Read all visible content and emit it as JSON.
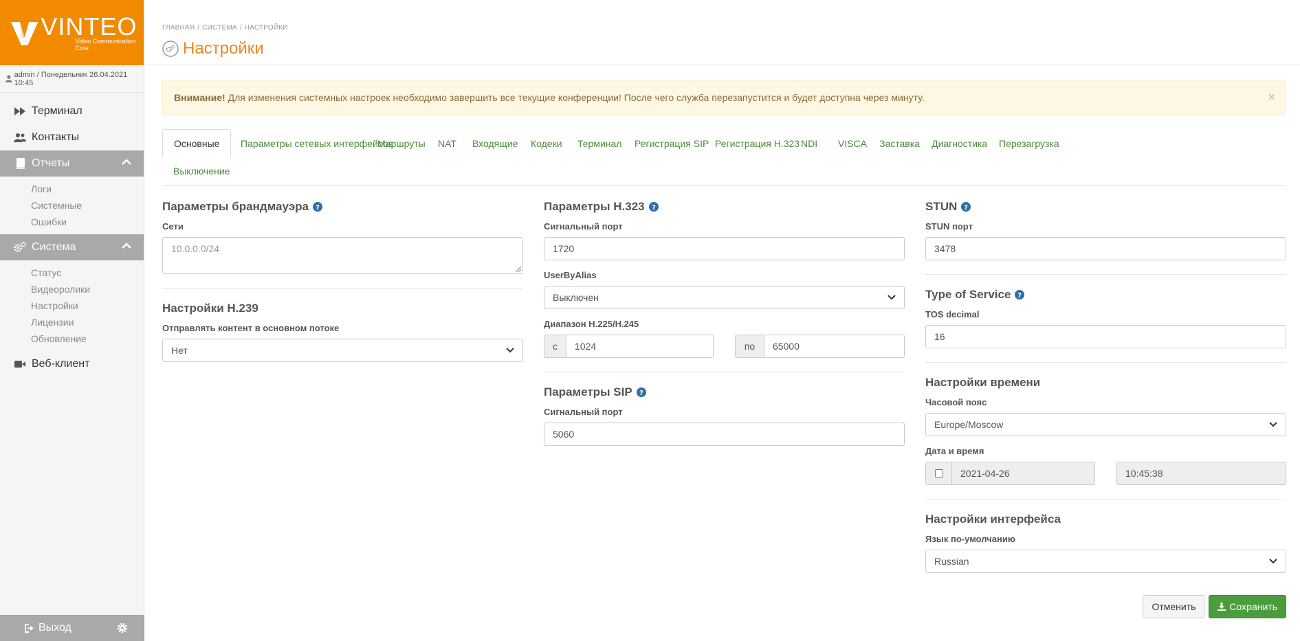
{
  "colors": {
    "brand": "#f28a00",
    "accent": "#e8891f",
    "link": "#4a8a3a",
    "success": "#4a9c3c"
  },
  "logo": {
    "name": "VINTEO",
    "sub": "Video Communication Core"
  },
  "user": {
    "line": "admin / Понедельник 26.04.2021 10:45"
  },
  "sidebar": {
    "items": [
      {
        "label": "Терминал",
        "icon": "fast-forward-icon"
      },
      {
        "label": "Контакты",
        "icon": "users-icon"
      },
      {
        "label": "Отчеты",
        "icon": "book-icon",
        "sub": [
          "Логи",
          "Системные",
          "Ошибки"
        ]
      },
      {
        "label": "Система",
        "icon": "cogs-icon",
        "sub": [
          "Статус",
          "Видеоролики",
          "Настройки",
          "Лицензии",
          "Обновление"
        ]
      },
      {
        "label": "Веб-клиент",
        "icon": "video-camera-icon"
      }
    ],
    "logout": "Выход"
  },
  "breadcrumb": [
    "Главная",
    "Система",
    "Настройки"
  ],
  "page_title": "Настройки",
  "alert": {
    "strong": "Внимание!",
    "text": "Для изменения системных настроек необходимо завершить все текущие конференции! После чего служба перезапустится и будет доступна через минуту.",
    "close": "×"
  },
  "tabs": [
    "Основные",
    "Параметры сетевых интерфейсов",
    "Маршруты",
    "NAT",
    "Входящие",
    "Кодеки",
    "Терминал",
    "Регистрация SIP",
    "Регистрация H.323",
    "NDI",
    "VISCA",
    "Заставка",
    "Диагностика",
    "Перезагрузка",
    "Выключение"
  ],
  "firewall": {
    "title": "Параметры брандмауэра",
    "nets_label": "Сети",
    "nets_value": "10.0.0.0/24"
  },
  "h239": {
    "title": "Настройки H.239",
    "label": "Отправлять контент в основном потоке",
    "value": "Нет"
  },
  "h323": {
    "title": "Параметры H.323",
    "port_label": "Сигнальный порт",
    "port_value": "1720",
    "alias_label": "UserByAlias",
    "alias_value": "Выключен",
    "range_label": "Диапазон H.225/H.245",
    "from_label": "с",
    "from_value": "1024",
    "to_label": "по",
    "to_value": "65000"
  },
  "sip": {
    "title": "Параметры SIP",
    "port_label": "Сигнальный порт",
    "port_value": "5060"
  },
  "stun": {
    "title": "STUN",
    "port_label": "STUN порт",
    "port_value": "3478"
  },
  "tos": {
    "title": "Type of Service",
    "label": "TOS decimal",
    "value": "16"
  },
  "time": {
    "title": "Настройки времени",
    "tz_label": "Часовой пояс",
    "tz_value": "Europe/Moscow",
    "dt_label": "Дата и время",
    "date_value": "2021-04-26",
    "time_value": "10:45:38"
  },
  "ui": {
    "title": "Настройки интерфейса",
    "lang_label": "Язык по-умолчанию",
    "lang_value": "Russian"
  },
  "buttons": {
    "cancel": "Отменить",
    "save": "Сохранить"
  }
}
